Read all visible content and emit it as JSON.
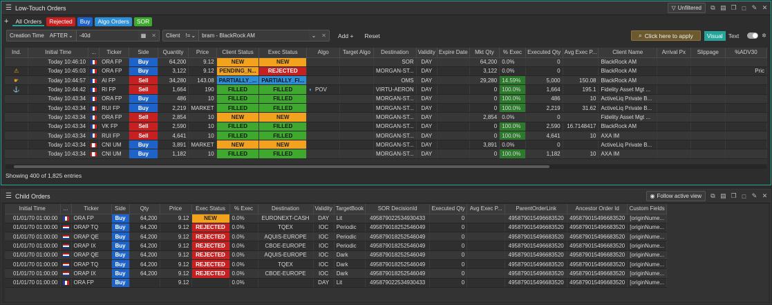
{
  "top": {
    "title": "Low-Touch Orders",
    "unfiltered_label": "Unfiltered",
    "tabs": [
      {
        "label": "All Orders",
        "color": ""
      },
      {
        "label": "Rejected",
        "color": "#c62020"
      },
      {
        "label": "Buy",
        "color": "#1e63c9"
      },
      {
        "label": "Algo Orders",
        "color": "#2f8fd6"
      },
      {
        "label": "SOR",
        "color": "#3fa82e"
      }
    ],
    "filters": {
      "creation_time_label": "Creation Time",
      "creation_op": "AFTER",
      "creation_value": "-40d",
      "client_label": "Client",
      "client_op": "!=",
      "client_value": "bram - BlackRock AM",
      "add_label": "Add",
      "reset_label": "Reset",
      "apply_label": "Click here to apply",
      "visual_label": "Visual",
      "text_label": "Text"
    },
    "columns": [
      "Ind.",
      "Initial Time",
      "...",
      "Ticker",
      "Side",
      "Quantity",
      "Price",
      "Client Status",
      "Exec Status",
      "Algo",
      "Target Algo",
      "Destination",
      "Validity",
      "Expire Date",
      "Mkt Qty",
      "% Exec",
      "Executed Qty",
      "Avg Exec P...",
      "Client Name",
      "Arrival Px",
      "Slippage",
      "%ADV30"
    ],
    "rows": [
      {
        "ind": "",
        "time": "Today 10:46:10",
        "flag": "fr",
        "ticker": "ORA FP",
        "side": "Buy",
        "qty": "64,200",
        "price": "9.12",
        "client_status": "NEW",
        "exec_status": "NEW",
        "algo": "",
        "target_algo": "",
        "dest": "SOR",
        "validity": "DAY",
        "expire": "",
        "mkt_qty": "64,200",
        "pct_exec": "0.0%",
        "exec_qty": "0",
        "avg_px": "",
        "client_name": "BlackRock AM",
        "arrival": "",
        "slippage": "",
        "adv": ""
      },
      {
        "ind": "warning",
        "time": "Today 10:45:03",
        "flag": "fr",
        "ticker": "ORA FP",
        "side": "Buy",
        "qty": "3,122",
        "price": "9.12",
        "client_status": "PENDING_N...",
        "exec_status": "REJECTED",
        "algo": "",
        "target_algo": "",
        "dest": "MORGAN-ST...",
        "validity": "DAY",
        "expire": "",
        "mkt_qty": "3,122",
        "pct_exec": "0.0%",
        "exec_qty": "0",
        "avg_px": "",
        "client_name": "BlackRock AM",
        "arrival": "",
        "slippage": "",
        "adv": "Pric"
      },
      {
        "ind": "hand",
        "time": "Today 10:44:57",
        "flag": "fr",
        "ticker": "AI FP",
        "side": "Sell",
        "qty": "34,280",
        "price": "143.08",
        "client_status": "PARTIALLY_...",
        "exec_status": "PARTIALLY_FI...",
        "algo": "",
        "target_algo": "",
        "dest": "OMS",
        "validity": "DAY",
        "expire": "",
        "mkt_qty": "29,280",
        "pct_exec": "14.59%",
        "exec_qty": "5,000",
        "avg_px": "150.08",
        "client_name": "BlackRock AM",
        "arrival": "",
        "slippage": "",
        "adv": ""
      },
      {
        "ind": "anchor",
        "time": "Today 10:44:42",
        "flag": "fr",
        "ticker": "RI FP",
        "side": "Sell",
        "qty": "1,664",
        "price": "190",
        "client_status": "FILLED",
        "exec_status": "FILLED",
        "algo": "POV",
        "target_algo": "",
        "dest": "VIRTU-AERON",
        "validity": "DAY",
        "expire": "",
        "mkt_qty": "0",
        "pct_exec": "100.0%",
        "exec_qty": "1,664",
        "avg_px": "195.1",
        "client_name": "Fidelity Asset Mgt ...",
        "arrival": "",
        "slippage": "",
        "adv": ""
      },
      {
        "ind": "",
        "time": "Today 10:43:34",
        "flag": "fr",
        "ticker": "ORA FP",
        "side": "Buy",
        "qty": "486",
        "price": "10",
        "client_status": "FILLED",
        "exec_status": "FILLED",
        "algo": "",
        "target_algo": "",
        "dest": "MORGAN-ST...",
        "validity": "DAY",
        "expire": "",
        "mkt_qty": "0",
        "pct_exec": "100.0%",
        "exec_qty": "486",
        "avg_px": "10",
        "client_name": "ActiveLiq Private B...",
        "arrival": "",
        "slippage": "",
        "adv": ""
      },
      {
        "ind": "",
        "time": "Today 10:43:34",
        "flag": "fr",
        "ticker": "RUI FP",
        "side": "Buy",
        "qty": "2,219",
        "price": "MARKET",
        "client_status": "FILLED",
        "exec_status": "FILLED",
        "algo": "",
        "target_algo": "",
        "dest": "MORGAN-ST...",
        "validity": "DAY",
        "expire": "",
        "mkt_qty": "0",
        "pct_exec": "100.0%",
        "exec_qty": "2,219",
        "avg_px": "31.62",
        "client_name": "ActiveLiq Private B...",
        "arrival": "",
        "slippage": "",
        "adv": ""
      },
      {
        "ind": "",
        "time": "Today 10:43:34",
        "flag": "fr",
        "ticker": "ORA FP",
        "side": "Sell",
        "qty": "2,854",
        "price": "10",
        "client_status": "NEW",
        "exec_status": "NEW",
        "algo": "",
        "target_algo": "",
        "dest": "MORGAN-ST...",
        "validity": "DAY",
        "expire": "",
        "mkt_qty": "2,854",
        "pct_exec": "0.0%",
        "exec_qty": "0",
        "avg_px": "",
        "client_name": "Fidelity Asset Mgt ...",
        "arrival": "",
        "slippage": "",
        "adv": ""
      },
      {
        "ind": "",
        "time": "Today 10:43:34",
        "flag": "fr",
        "ticker": "VK FP",
        "side": "Sell",
        "qty": "2,590",
        "price": "10",
        "client_status": "FILLED",
        "exec_status": "FILLED",
        "algo": "",
        "target_algo": "",
        "dest": "MORGAN-ST...",
        "validity": "DAY",
        "expire": "",
        "mkt_qty": "0",
        "pct_exec": "100.0%",
        "exec_qty": "2,590",
        "avg_px": "16.7148417",
        "client_name": "BlackRock AM",
        "arrival": "",
        "slippage": "",
        "adv": ""
      },
      {
        "ind": "",
        "time": "Today 10:43:34",
        "flag": "fr",
        "ticker": "RUI FP",
        "side": "Sell",
        "qty": "4,641",
        "price": "10",
        "client_status": "FILLED",
        "exec_status": "FILLED",
        "algo": "",
        "target_algo": "",
        "dest": "MORGAN-ST...",
        "validity": "DAY",
        "expire": "",
        "mkt_qty": "0",
        "pct_exec": "100.0%",
        "exec_qty": "4,641",
        "avg_px": "10",
        "client_name": "AXA IM",
        "arrival": "",
        "slippage": "",
        "adv": ""
      },
      {
        "ind": "",
        "time": "Today 10:43:34",
        "flag": "ca",
        "ticker": "CNI UM",
        "side": "Buy",
        "qty": "3,891",
        "price": "MARKET",
        "client_status": "NEW",
        "exec_status": "NEW",
        "algo": "",
        "target_algo": "",
        "dest": "MORGAN-ST...",
        "validity": "DAY",
        "expire": "",
        "mkt_qty": "3,891",
        "pct_exec": "0.0%",
        "exec_qty": "0",
        "avg_px": "",
        "client_name": "ActiveLiq Private B...",
        "arrival": "",
        "slippage": "",
        "adv": ""
      },
      {
        "ind": "",
        "time": "Today 10:43:34",
        "flag": "ca",
        "ticker": "CNI UM",
        "side": "Buy",
        "qty": "1,182",
        "price": "10",
        "client_status": "FILLED",
        "exec_status": "FILLED",
        "algo": "",
        "target_algo": "",
        "dest": "MORGAN-ST...",
        "validity": "DAY",
        "expire": "",
        "mkt_qty": "0",
        "pct_exec": "100.0%",
        "exec_qty": "1,182",
        "avg_px": "10",
        "client_name": "AXA IM",
        "arrival": "",
        "slippage": "",
        "adv": ""
      }
    ],
    "status_text": "Showing 400 of 1,825 entries"
  },
  "bottom": {
    "title": "Child Orders",
    "follow_label": "Follow active view",
    "columns": [
      "Initial Time",
      "...",
      "Ticker",
      "Side",
      "Qty",
      "Price",
      "Exec Status",
      "% Exec",
      "Destination",
      "Validity",
      "TargetBook",
      "SOR DecisionId",
      "Executed Qty",
      "Avg Exec P...",
      "ParentOrderLink",
      "Ancestor Order Id",
      "Custom Fields"
    ],
    "rows": [
      {
        "time": "01/01/70 01:00:00",
        "flag": "fr",
        "ticker": "ORA FP",
        "side": "Buy",
        "qty": "64,200",
        "price": "9.12",
        "status": "NEW",
        "pct": "0.0%",
        "dest": "EURONEXT-CASH",
        "validity": "DAY",
        "book": "Lit",
        "sor": "4958790225349304​33",
        "exec_qty": "0",
        "avg": "",
        "parent": "4958790154966835​20",
        "ancestor": "4958790154966835​20",
        "custom": "[originNume..."
      },
      {
        "time": "01/01/70 01:00:00",
        "flag": "nl",
        "ticker": "ORAP TQ",
        "side": "Buy",
        "qty": "64,200",
        "price": "9.12",
        "status": "REJECTED",
        "pct": "0.0%",
        "dest": "TQEX",
        "validity": "IOC",
        "book": "Periodic",
        "sor": "4958790182525460​49",
        "exec_qty": "0",
        "avg": "",
        "parent": "4958790154966835​20",
        "ancestor": "4958790154966835​20",
        "custom": "[originNume..."
      },
      {
        "time": "01/01/70 01:00:00",
        "flag": "nl",
        "ticker": "ORAP QE",
        "side": "Buy",
        "qty": "64,200",
        "price": "9.12",
        "status": "REJECTED",
        "pct": "0.0%",
        "dest": "AQUIS-EUROPE",
        "validity": "IOC",
        "book": "Periodic",
        "sor": "4958790182525460​49",
        "exec_qty": "0",
        "avg": "",
        "parent": "4958790154966835​20",
        "ancestor": "4958790154966835​20",
        "custom": "[originNume..."
      },
      {
        "time": "01/01/70 01:00:00",
        "flag": "nl",
        "ticker": "ORAP IX",
        "side": "Buy",
        "qty": "64,200",
        "price": "9.12",
        "status": "REJECTED",
        "pct": "0.0%",
        "dest": "CBOE-EUROPE",
        "validity": "IOC",
        "book": "Periodic",
        "sor": "4958790182525460​49",
        "exec_qty": "0",
        "avg": "",
        "parent": "4958790154966835​20",
        "ancestor": "4958790154966835​20",
        "custom": "[originNume..."
      },
      {
        "time": "01/01/70 01:00:00",
        "flag": "nl",
        "ticker": "ORAP QE",
        "side": "Buy",
        "qty": "64,200",
        "price": "9.12",
        "status": "REJECTED",
        "pct": "0.0%",
        "dest": "AQUIS-EUROPE",
        "validity": "IOC",
        "book": "Dark",
        "sor": "4958790182525460​49",
        "exec_qty": "0",
        "avg": "",
        "parent": "4958790154966835​20",
        "ancestor": "4958790154966835​20",
        "custom": "[originNume..."
      },
      {
        "time": "01/01/70 01:00:00",
        "flag": "nl",
        "ticker": "ORAP TQ",
        "side": "Buy",
        "qty": "64,200",
        "price": "9.12",
        "status": "REJECTED",
        "pct": "0.0%",
        "dest": "TQEX",
        "validity": "IOC",
        "book": "Dark",
        "sor": "4958790182525460​49",
        "exec_qty": "0",
        "avg": "",
        "parent": "4958790154966835​20",
        "ancestor": "4958790154966835​20",
        "custom": "[originNume..."
      },
      {
        "time": "01/01/70 01:00:00",
        "flag": "nl",
        "ticker": "ORAP IX",
        "side": "Buy",
        "qty": "64,200",
        "price": "9.12",
        "status": "REJECTED",
        "pct": "0.0%",
        "dest": "CBOE-EUROPE",
        "validity": "IOC",
        "book": "Dark",
        "sor": "4958790182525460​49",
        "exec_qty": "0",
        "avg": "",
        "parent": "4958790154966835​20",
        "ancestor": "4958790154966835​20",
        "custom": "[originNume..."
      },
      {
        "time": "01/01/70 01:00:00",
        "flag": "fr",
        "ticker": "ORA FP",
        "side": "Buy",
        "qty": "",
        "price": "9.12",
        "status": "",
        "pct": "0.0%",
        "dest": "",
        "validity": "DAY",
        "book": "Lit",
        "sor": "4958790225349304​33",
        "exec_qty": "0",
        "avg": "",
        "parent": "4958790154966835​20",
        "ancestor": "4958790154966835​20",
        "custom": "[originNume..."
      }
    ]
  }
}
